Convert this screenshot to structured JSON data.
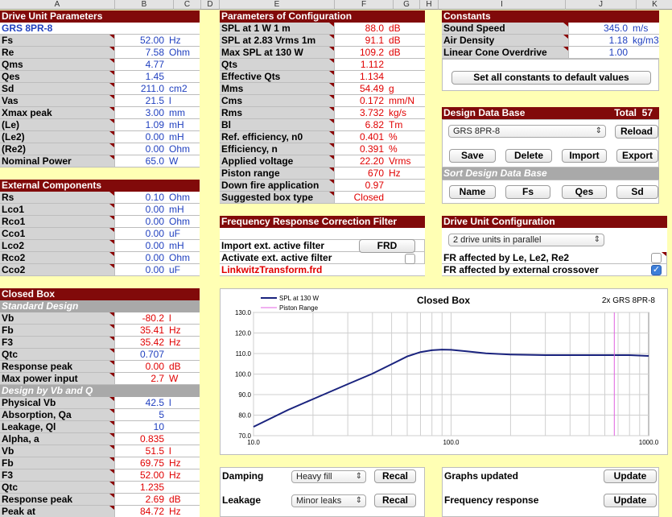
{
  "columns": [
    "A",
    "B",
    "C",
    "D",
    "E",
    "F",
    "G",
    "H",
    "I",
    "J",
    "K"
  ],
  "drive": {
    "title": "Drive Unit Parameters",
    "model": "GRS 8PR-8",
    "rows": [
      [
        "Fs",
        "52.00",
        "Hz"
      ],
      [
        "Re",
        "7.58",
        "Ohm"
      ],
      [
        "Qms",
        "4.77",
        ""
      ],
      [
        "Qes",
        "1.45",
        ""
      ],
      [
        "Sd",
        "211.0",
        "cm2"
      ],
      [
        "Vas",
        "21.5",
        "l"
      ],
      [
        "Xmax peak",
        "3.00",
        "mm"
      ],
      [
        "(Le)",
        "1.09",
        "mH"
      ],
      [
        "(Le2)",
        "0.00",
        "mH"
      ],
      [
        "(Re2)",
        "0.00",
        "Ohm"
      ],
      [
        "Nominal Power",
        "65.0",
        "W"
      ]
    ]
  },
  "external": {
    "title": "External Components",
    "rows": [
      [
        "Rs",
        "0.10",
        "Ohm"
      ],
      [
        "Lco1",
        "0.00",
        "mH"
      ],
      [
        "Rco1",
        "0.00",
        "Ohm"
      ],
      [
        "Cco1",
        "0.00",
        "uF"
      ],
      [
        "Lco2",
        "0.00",
        "mH"
      ],
      [
        "Rco2",
        "0.00",
        "Ohm"
      ],
      [
        "Cco2",
        "0.00",
        "uF"
      ]
    ]
  },
  "closed": {
    "title": "Closed Box",
    "standard_title": "Standard Design",
    "standard_rows": [
      [
        "Vb",
        "-80.2",
        "l"
      ],
      [
        "Fb",
        "35.41",
        "Hz"
      ],
      [
        "F3",
        "35.42",
        "Hz"
      ],
      [
        "Qtc",
        "0.707",
        ""
      ],
      [
        "Response peak",
        "0.00",
        "dB"
      ],
      [
        "Max power input",
        "2.7",
        "W"
      ]
    ],
    "vbq_title": "Design by Vb and Q",
    "vbq_rows": [
      [
        "Physical Vb",
        "42.5",
        "l"
      ],
      [
        "Absorption, Qa",
        "5",
        ""
      ],
      [
        "Leakage, Ql",
        "10",
        ""
      ],
      [
        "Alpha, a",
        "0.835",
        ""
      ],
      [
        "Vb",
        "51.5",
        "l"
      ],
      [
        "Fb",
        "69.75",
        "Hz"
      ],
      [
        "F3",
        "52.00",
        "Hz"
      ],
      [
        "Qtc",
        "1.235",
        ""
      ],
      [
        "Response peak",
        "2.69",
        "dB"
      ],
      [
        "Peak at",
        "84.72",
        "Hz"
      ]
    ]
  },
  "config": {
    "title": "Parameters of Configuration",
    "rows": [
      [
        "SPL at 1 W 1 m",
        "88.0",
        "dB"
      ],
      [
        "SPL at 2.83 Vrms 1m",
        "91.1",
        "dB"
      ],
      [
        "Max SPL at 130 W",
        "109.2",
        "dB"
      ],
      [
        "Qts",
        "1.112",
        ""
      ],
      [
        "Effective Qts",
        "1.134",
        ""
      ],
      [
        "Mms",
        "54.49",
        "g"
      ],
      [
        "Cms",
        "0.172",
        "mm/N"
      ],
      [
        "Rms",
        "3.732",
        "kg/s"
      ],
      [
        "Bl",
        "6.82",
        "Tm"
      ],
      [
        "Ref. efficiency, n0",
        "0.401",
        "%"
      ],
      [
        "Efficiency, n",
        "0.391",
        "%"
      ],
      [
        "Applied voltage",
        "22.20",
        "Vrms"
      ],
      [
        "Piston range",
        "670",
        "Hz"
      ],
      [
        "Down fire application",
        "0.97",
        ""
      ],
      [
        "Suggested box type",
        "Closed",
        ""
      ]
    ]
  },
  "constants": {
    "title": "Constants",
    "rows": [
      [
        "Sound Speed",
        "345.0",
        "m/s"
      ],
      [
        "Air Density",
        "1.18",
        "kg/m3"
      ],
      [
        "Linear Cone Overdrive",
        "1.00",
        ""
      ]
    ],
    "reset_button": "Set all constants to default values"
  },
  "database": {
    "title": "Design Data Base",
    "total_label": "Total",
    "total": "57",
    "selected": "GRS 8PR-8",
    "reload": "Reload",
    "save": "Save",
    "delete": "Delete",
    "import": "Import",
    "export": "Export",
    "sort_title": "Sort Design Data Base",
    "sort_name": "Name",
    "sort_fs": "Fs",
    "sort_qes": "Qes",
    "sort_sd": "Sd"
  },
  "filter": {
    "title": "Frequency Response Correction Filter",
    "import_label": "Import ext. active filter",
    "frd_button": "FRD",
    "activate_label": "Activate ext. active filter",
    "file": "LinkwitzTransform.frd"
  },
  "driveconf": {
    "title": "Drive Unit Configuration",
    "selected": "2 drive units in parallel",
    "le_label": "FR affected by Le, Le2, Re2",
    "xo_label": "FR affected by external crossover"
  },
  "bottom": {
    "damping_label": "Damping",
    "damping_value": "Heavy fill",
    "leakage_label": "Leakage",
    "leakage_value": "Minor leaks",
    "recal": "Recal",
    "graphs_label": "Graphs updated",
    "freq_label": "Frequency response",
    "update": "Update"
  },
  "chart_data": {
    "type": "line",
    "title": "Closed Box",
    "subtitle": "2x GRS 8PR-8",
    "xscale": "log",
    "xlim": [
      10,
      1000
    ],
    "ylim": [
      70,
      130
    ],
    "xticks": [
      "10.0",
      "100.0",
      "1000.0"
    ],
    "yticks": [
      "70.0",
      "80.0",
      "90.0",
      "100.0",
      "110.0",
      "120.0",
      "130.0"
    ],
    "series": [
      {
        "name": "SPL at 130 W",
        "color": "#1a237e",
        "x": [
          10,
          15,
          20,
          30,
          40,
          50,
          60,
          70,
          80,
          90,
          100,
          120,
          150,
          200,
          300,
          500,
          700,
          800,
          1000
        ],
        "y": [
          74.3,
          82.6,
          87.8,
          95.1,
          100.2,
          104.8,
          108.6,
          110.7,
          111.6,
          111.9,
          111.8,
          111.1,
          110.1,
          109.5,
          109.2,
          109.2,
          109.2,
          109.2,
          108.8
        ]
      },
      {
        "name": "Piston Range",
        "color": "#e060e0",
        "x": [
          670,
          670
        ],
        "y": [
          70,
          130
        ]
      }
    ]
  }
}
